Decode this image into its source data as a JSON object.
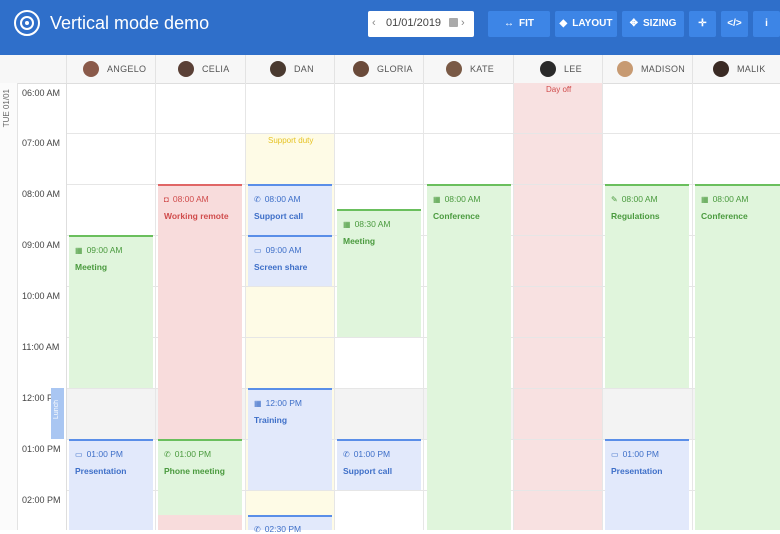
{
  "app": {
    "title": "Vertical mode demo"
  },
  "toolbar": {
    "date": "01/01/2019",
    "fit_label": "FIT",
    "layout_label": "LAYOUT",
    "sizing_label": "SIZING",
    "move_icon": "move-icon",
    "code_icon": "code-icon",
    "info_icon": "info-icon"
  },
  "date_column": {
    "label": "TUE 01/01"
  },
  "resources": [
    "ANGELO",
    "CELIA",
    "DAN",
    "GLORIA",
    "KATE",
    "LEE",
    "MADISON",
    "MALIK"
  ],
  "times": [
    "06:00 AM",
    "07:00 AM",
    "08:00 AM",
    "09:00 AM",
    "10:00 AM",
    "11:00 AM",
    "12:00 P",
    "01:00 PM",
    "02:00 PM"
  ],
  "lunch": {
    "label": "Lunch"
  },
  "timeranges": {
    "support_duty": "Support duty",
    "day_off": "Day off"
  },
  "events": {
    "angelo_meeting": {
      "time": "09:00 AM",
      "name": "Meeting",
      "icon": "calendar-icon"
    },
    "angelo_presentation": {
      "time": "01:00 PM",
      "name": "Presentation",
      "icon": "monitor-icon"
    },
    "celia_remote": {
      "time": "08:00 AM",
      "name": "Working remote",
      "icon": "car-icon"
    },
    "celia_phone": {
      "time": "01:00 PM",
      "name": "Phone meeting",
      "icon": "phone-icon"
    },
    "dan_support": {
      "time": "08:00 AM",
      "name": "Support call",
      "icon": "phone-icon"
    },
    "dan_share": {
      "time": "09:00 AM",
      "name": "Screen share",
      "icon": "monitor-icon"
    },
    "dan_training": {
      "time": "12:00 PM",
      "name": "Training",
      "icon": "calendar-icon"
    },
    "dan_next": {
      "time": "02:30 PM",
      "icon": "phone-icon"
    },
    "gloria_meeting": {
      "time": "08:30 AM",
      "name": "Meeting",
      "icon": "calendar-icon"
    },
    "gloria_support": {
      "time": "01:00 PM",
      "name": "Support call",
      "icon": "phone-icon"
    },
    "kate_conf": {
      "time": "08:00 AM",
      "name": "Conference",
      "icon": "calendar-icon"
    },
    "madison_reg": {
      "time": "08:00 AM",
      "name": "Regulations",
      "icon": "wrench-icon"
    },
    "madison_pres": {
      "time": "01:00 PM",
      "name": "Presentation",
      "icon": "monitor-icon"
    },
    "malik_conf": {
      "time": "08:00 AM",
      "name": "Conference",
      "icon": "calendar-icon"
    }
  },
  "colors": {
    "header": "#2f6fca",
    "button": "#3d85e6",
    "green": "#6abf5d",
    "red": "#e06666",
    "blue": "#5a8ee8",
    "yellow_text": "#e6c323"
  }
}
